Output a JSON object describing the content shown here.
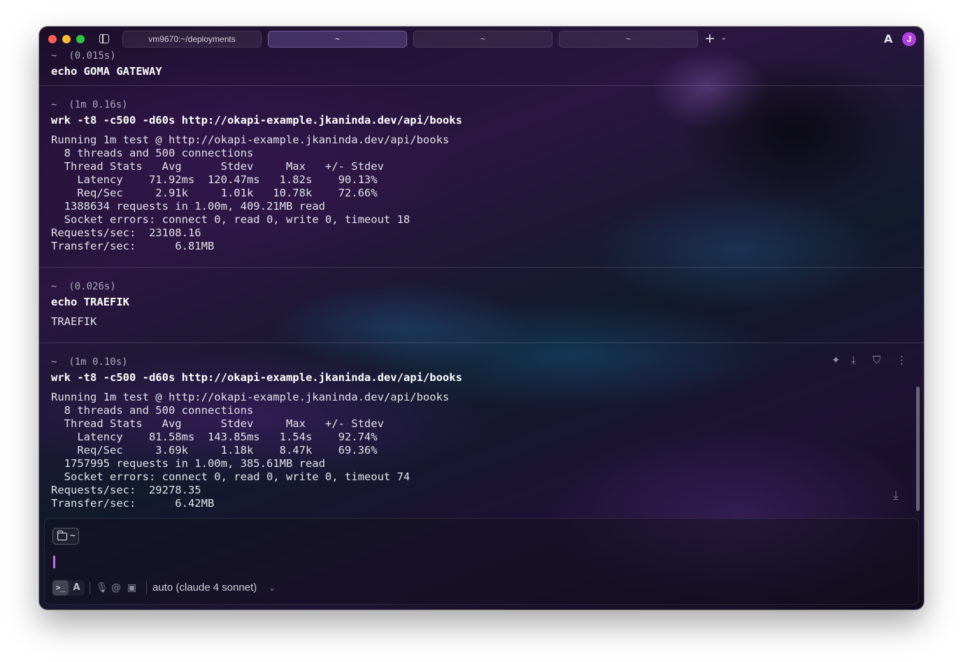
{
  "titlebar": {
    "tabs": [
      {
        "label": "vm9670:~/deployments",
        "active": false
      },
      {
        "label": "~",
        "active": true
      },
      {
        "label": "~",
        "active": false
      },
      {
        "label": "~",
        "active": false
      }
    ],
    "new_tab_icon": "+",
    "new_tab_menu_icon": "⌄",
    "agent_icon": "A",
    "avatar_initial": "J"
  },
  "blocks": [
    {
      "prompt": "~  (0.015s)",
      "command": "echo GOMA GATEWAY",
      "output": ""
    },
    {
      "prompt": "~  (1m 0.16s)",
      "command": "wrk -t8 -c500 -d60s http://okapi-example.jkaninda.dev/api/books",
      "output": "Running 1m test @ http://okapi-example.jkaninda.dev/api/books\n  8 threads and 500 connections\n  Thread Stats   Avg      Stdev     Max   +/- Stdev\n    Latency    71.92ms  120.47ms   1.82s    90.13%\n    Req/Sec     2.91k     1.01k   10.78k    72.66%\n  1388634 requests in 1.00m, 409.21MB read\n  Socket errors: connect 0, read 0, write 0, timeout 18\nRequests/sec:  23108.16\nTransfer/sec:      6.81MB"
    },
    {
      "prompt": "~  (0.026s)",
      "command": "echo TRAEFIK",
      "output": "TRAEFIK"
    },
    {
      "prompt": "~  (1m 0.10s)",
      "command": "wrk -t8 -c500 -d60s http://okapi-example.jkaninda.dev/api/books",
      "output": "Running 1m test @ http://okapi-example.jkaninda.dev/api/books\n  8 threads and 500 connections\n  Thread Stats   Avg      Stdev     Max   +/- Stdev\n    Latency    81.58ms  143.85ms   1.54s    92.74%\n    Req/Sec     3.69k     1.18k    8.47k    69.36%\n  1757995 requests in 1.00m, 385.61MB read\n  Socket errors: connect 0, read 0, write 0, timeout 74\nRequests/sec:  29278.35\nTransfer/sec:      6.42MB"
    }
  ],
  "block_tools": [
    "sparkle-icon",
    "save-icon",
    "filter-icon",
    "more-icon"
  ],
  "input": {
    "directory": "~",
    "mode_terminal_icon": ">_",
    "mode_agent_icon": "A",
    "model": "auto (claude 4 sonnet)",
    "accent": "#c46cf0"
  }
}
